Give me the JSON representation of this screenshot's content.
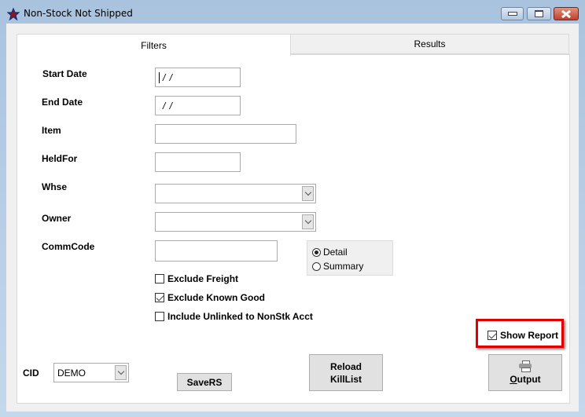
{
  "window": {
    "title": "Non-Stock Not Shipped",
    "icon": "star-app-icon",
    "controls": [
      "minimize",
      "maximize",
      "close"
    ]
  },
  "tabs": [
    {
      "label": "Filters",
      "active": true
    },
    {
      "label": "Results",
      "active": false
    }
  ],
  "filters": {
    "start_date": {
      "label": "Start Date",
      "value": " /  / "
    },
    "end_date": {
      "label": "End Date",
      "value": " /  / "
    },
    "item": {
      "label": "Item",
      "value": ""
    },
    "held_for": {
      "label": "HeldFor",
      "value": ""
    },
    "whse": {
      "label": "Whse",
      "value": ""
    },
    "owner": {
      "label": "Owner",
      "value": ""
    },
    "comm_code": {
      "label": "CommCode",
      "value": ""
    },
    "report_type": {
      "options": [
        {
          "label": "Detail",
          "selected": true
        },
        {
          "label": "Summary",
          "selected": false
        }
      ]
    },
    "checkboxes": [
      {
        "label": "Exclude Freight",
        "checked": false
      },
      {
        "label": "Exclude Known Good",
        "checked": true
      },
      {
        "label": "Include Unlinked to NonStk Acct",
        "checked": false
      }
    ],
    "show_report": {
      "label": "Show Report",
      "checked": true
    }
  },
  "footer": {
    "cid_label": "CID",
    "cid_value": "DEMO",
    "save_rs_label": "SaveRS",
    "reload_label_line1": "Reload",
    "reload_label_line2": "KillList",
    "output_label_accel": "O",
    "output_label_rest": "utput"
  },
  "colors": {
    "highlight": "#e00000",
    "close_button": "#c0412b"
  }
}
